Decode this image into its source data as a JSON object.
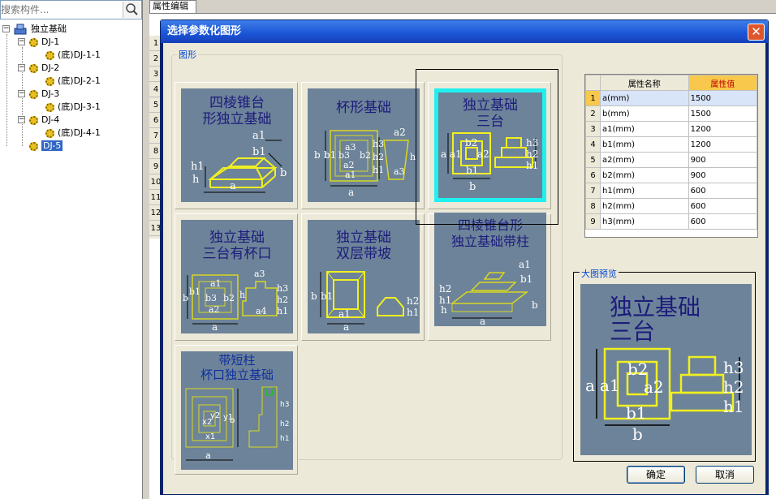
{
  "search": {
    "placeholder": "搜索构件..."
  },
  "tree": {
    "root_label": "独立基础",
    "items": [
      {
        "label": "DJ-1",
        "child": "(底)DJ-1-1"
      },
      {
        "label": "DJ-2",
        "child": "(底)DJ-2-1"
      },
      {
        "label": "DJ-3",
        "child": "(底)DJ-3-1"
      },
      {
        "label": "DJ-4",
        "child": "(底)DJ-4-1"
      }
    ],
    "selected": "DJ-5"
  },
  "background": {
    "tab_label": "属性编辑",
    "row_numbers": [
      "1",
      "2",
      "3",
      "4",
      "5",
      "6",
      "7",
      "8",
      "9",
      "10",
      "11",
      "12",
      "13"
    ]
  },
  "dialog": {
    "title": "选择参数化图形",
    "close_glyph": "✕",
    "shape_group_label": "图形",
    "shapes": [
      {
        "title": "四棱锥台\n形独立基础",
        "labels": [
          "a1",
          "b1",
          "h1",
          "h",
          "a",
          "b"
        ]
      },
      {
        "title": "杯形基础",
        "labels": [
          "a2",
          "b",
          "b1",
          "b3",
          "a3",
          "b2",
          "a2",
          "a1",
          "h3",
          "h2",
          "h1",
          "h",
          "a3",
          "a"
        ]
      },
      {
        "title": "独立基础\n三台",
        "labels": [
          "a",
          "a1",
          "b2",
          "a2",
          "b1",
          "b",
          "h3",
          "h2",
          "h1"
        ]
      },
      {
        "title": "独立基础\n三台有杯口",
        "labels": [
          "a1",
          "a3",
          "b1",
          "b3",
          "b",
          "a2",
          "b2",
          "a",
          "h",
          "a4",
          "h3",
          "h2",
          "h1"
        ]
      },
      {
        "title": "独立基础\n双层带坡",
        "labels": [
          "a",
          "b",
          "b1",
          "a1",
          "h2",
          "h1"
        ]
      },
      {
        "title": "四棱锥台形\n独立基础带柱",
        "labels": [
          "a1",
          "b1",
          "h2",
          "h1",
          "h",
          "b",
          "a"
        ]
      },
      {
        "title": "带短柱\n杯口独立基础",
        "labels": [
          "x2",
          "y2",
          "x1",
          "y1",
          "b",
          "a",
          "h3",
          "h2",
          "h1"
        ]
      }
    ],
    "selected_shape": "独立基础三台",
    "property_table": {
      "headers": [
        "属性名称",
        "属性值"
      ],
      "rows": [
        {
          "num": "1",
          "name": "a(mm)",
          "value": "1500"
        },
        {
          "num": "2",
          "name": "b(mm)",
          "value": "1500"
        },
        {
          "num": "3",
          "name": "a1(mm)",
          "value": "1200"
        },
        {
          "num": "4",
          "name": "b1(mm)",
          "value": "1200"
        },
        {
          "num": "5",
          "name": "a2(mm)",
          "value": "900"
        },
        {
          "num": "6",
          "name": "b2(mm)",
          "value": "900"
        },
        {
          "num": "7",
          "name": "h1(mm)",
          "value": "600"
        },
        {
          "num": "8",
          "name": "h2(mm)",
          "value": "600"
        },
        {
          "num": "9",
          "name": "h3(mm)",
          "value": "600"
        }
      ]
    },
    "preview": {
      "group_label": "大图预览",
      "title": "独立基础\n三台",
      "labels": [
        "a",
        "a1",
        "b2",
        "a2",
        "b1",
        "b",
        "h3",
        "h2",
        "h1"
      ]
    },
    "ok_label": "确定",
    "cancel_label": "取消"
  },
  "colors": {
    "thumb_bg": "#6d8399",
    "drawing_yellow": "#f0f020",
    "title_blue": "#1c1c7c",
    "selection_cyan": "#1ff0f0",
    "header_orange": "#f7c84c"
  }
}
